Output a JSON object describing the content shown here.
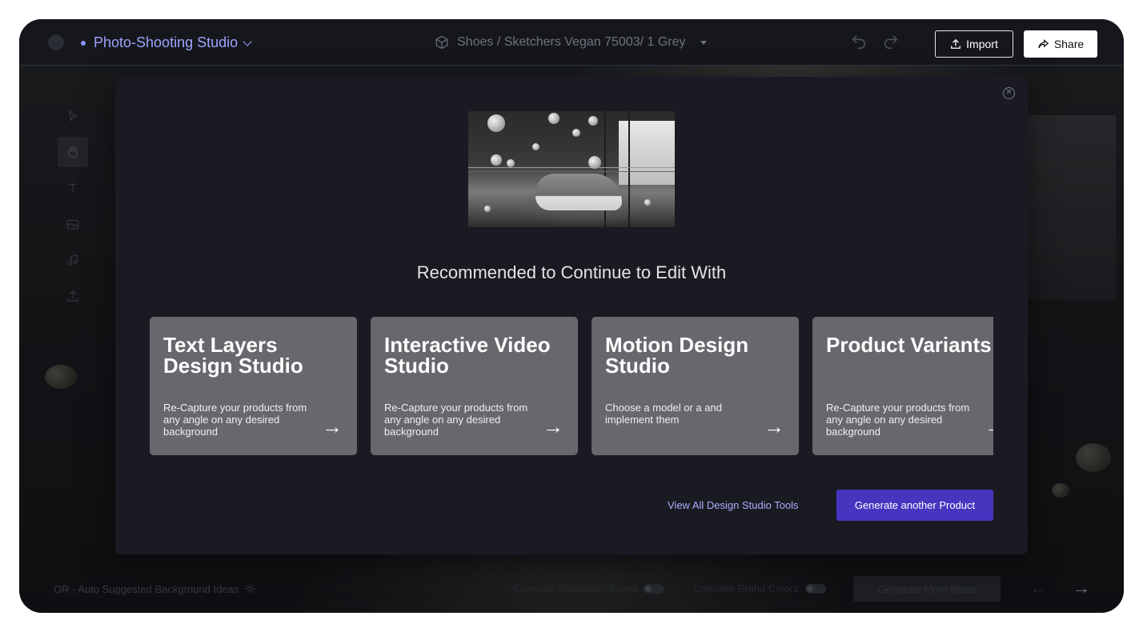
{
  "header": {
    "studio_title": "Photo-Shooting Studio",
    "breadcrumb": "Shoes / Sketchers Vegan 75003/ 1 Grey",
    "import_label": "Import",
    "share_label": "Share"
  },
  "bottom_bar": {
    "auto_suggest": "OR - Auto Suggested Background Ideas",
    "inspiration_label": "Consider Inspiration Board",
    "brand_colors_label": "Consider Brand Colors",
    "generate_more_label": "Generate More Ideas"
  },
  "modal": {
    "heading": "Recommended to Continue to Edit With",
    "cards": [
      {
        "title": "Text Layers Design Studio",
        "desc": "Re-Capture your products from any angle on any desired background"
      },
      {
        "title": "Interactive Video Studio",
        "desc": "Re-Capture your products from any angle on any desired background"
      },
      {
        "title": "Motion Design Studio",
        "desc": "Choose a model or a and implement them"
      },
      {
        "title": "Product Variants",
        "desc": "Re-Capture your products from any angle on any desired background"
      }
    ],
    "view_all_label": "View All Design Studio Tools",
    "generate_label": "Generate another Product"
  },
  "colors": {
    "accent": "#4735c0",
    "studio_title": "#9da2ff",
    "card_bg": "#67686d",
    "modal_bg": "#1a1b22"
  }
}
